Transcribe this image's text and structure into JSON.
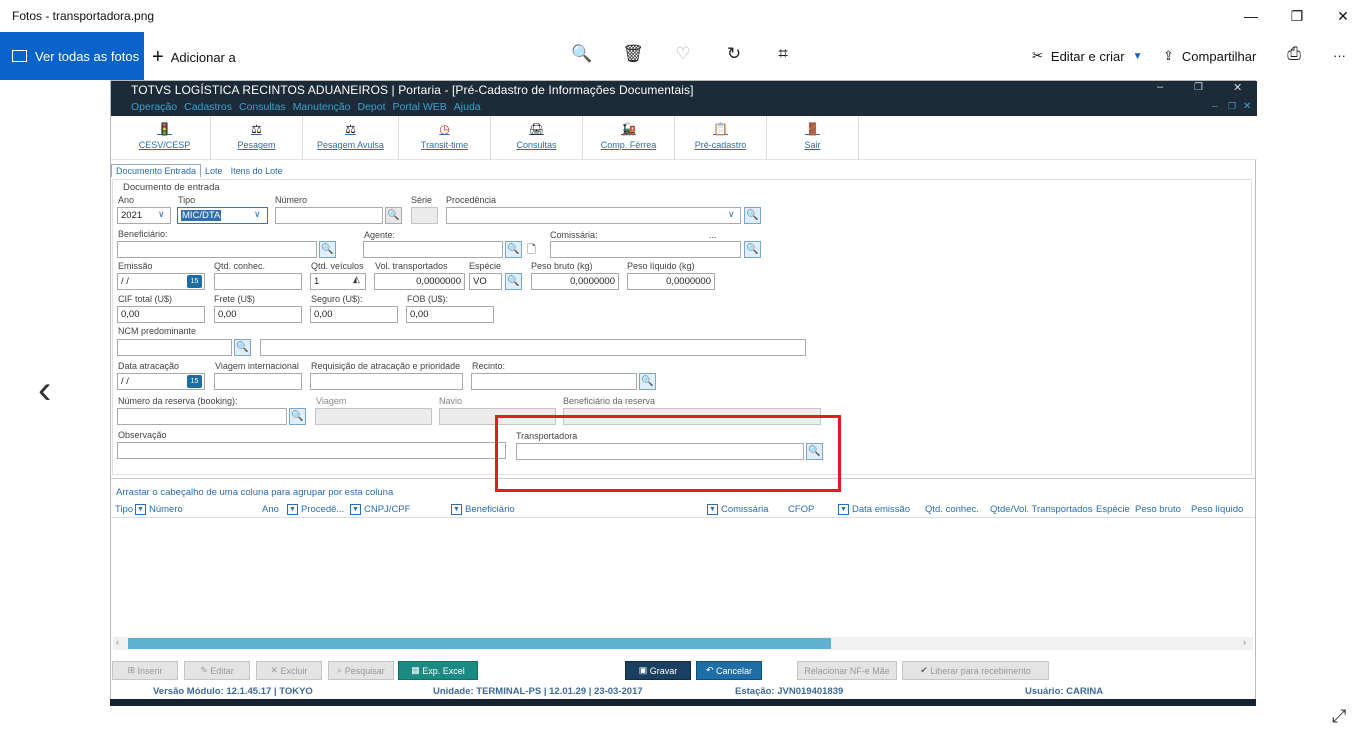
{
  "window": {
    "title": "Fotos - transportadora.png",
    "controls": [
      "—",
      "❐",
      "✕"
    ]
  },
  "photos_toolbar": {
    "view_all": "Ver todas as fotos",
    "add": "Adicionar a",
    "edit_create": "Editar e criar",
    "share": "Compartilhar",
    "more": "···"
  },
  "app": {
    "title": "TOTVS LOGÍSTICA RECINTOS ADUANEIROS | Portaria - [Pré-Cadastro de Informações Documentais]",
    "menu": [
      "Operação",
      "Cadastros",
      "Consultas",
      "Manutenção",
      "Depot",
      "Portal WEB",
      "Ajuda"
    ],
    "window_controls": [
      "–",
      "❐",
      "✕"
    ],
    "sub_controls": [
      "–",
      "❐",
      "✕"
    ],
    "toolbar": [
      "CESV/CESP",
      "Pesagem",
      "Pesagem Avulsa",
      "Transit-time",
      "Consultas",
      "Comp. Férrea",
      "Pré-cadastro",
      "Sair"
    ],
    "tabs": [
      "Documento Entrada",
      "Lote",
      "Itens do Lote"
    ],
    "form": {
      "group_title": "Documento de entrada",
      "ano_label": "Ano",
      "ano_value": "2021",
      "tipo_label": "Tipo",
      "tipo_value": "MIC/DTA",
      "numero_label": "Número",
      "serie_label": "Série",
      "procedencia_label": "Procedência",
      "beneficiario_label": "Beneficiário:",
      "agente_label": "Agente:",
      "comissaria_label": "Comissária:",
      "ellipsis": "...",
      "emissao_label": "Emissão",
      "emissao_value": " / /",
      "qtd_conhec_label": "Qtd. conhec.",
      "qtd_veiculos_label": "Qtd. veículos",
      "qtd_veiculos_value": "1",
      "vol_transportados_label": "Vol. transportados",
      "vol_transportados_value": "0,0000000",
      "especie_label": "Espécie",
      "especie_value": "VO",
      "peso_bruto_label": "Peso bruto (kg)",
      "peso_bruto_value": "0,0000000",
      "peso_liquido_label": "Peso líquido (kg)",
      "peso_liquido_value": "0,0000000",
      "cif_label": "CIF total (U$)",
      "cif_value": "0,00",
      "frete_label": "Frete (U$)",
      "frete_value": "0,00",
      "seguro_label": "Seguro (U$):",
      "seguro_value": "0,00",
      "fob_label": "FOB (U$):",
      "fob_value": "0,00",
      "ncm_label": "NCM predominante",
      "data_atracacao_label": "Data atracação",
      "data_atracacao_value": " / /",
      "viagem_internacional_label": "Viagem internacional",
      "requisicao_label": "Requisição de atracação e prioridade",
      "recinto_label": "Recinto:",
      "reserva_label": "Número da reserva (booking):",
      "viagem_label": "Viagem",
      "navio_label": "Navio",
      "beneficiario_reserva_label": "Beneficiário da reserva",
      "observacao_label": "Observação",
      "transportadora_label": "Transportadora"
    },
    "grid": {
      "hint": "Arrastar o cabeçalho de uma coluna para agrupar por esta coluna",
      "columns": [
        "Tipo",
        "Número",
        "Ano",
        "Procedê...",
        "CNPJ/CPF",
        "Beneficiário",
        "Comissária",
        "CFOP",
        "Data emissão",
        "Qtd. conhec.",
        "Qtde/Vol. Transportados",
        "Espécie",
        "Peso bruto",
        "Peso líquido"
      ]
    },
    "buttons": {
      "inserir": "Inserir",
      "editar": "Editar",
      "excluir": "Excluir",
      "pesquisar": "Pesquisar",
      "exp_excel": "Exp. Excel",
      "gravar": "Gravar",
      "cancelar": "Cancelar",
      "relacionar": "Relacionar NF-e Mãe",
      "liberar": "Liberar para recebimento"
    },
    "status": {
      "versao": "Versão Módulo:  12.1.45.17  |  TOKYO",
      "unidade": "Unidade:  TERMINAL-PS | 12.01.29 | 23-03-2017",
      "estacao": "Estação:  JVN019401839",
      "usuario": "Usuário:  CARINA"
    }
  },
  "colors": {
    "accent": "#0a63c9",
    "app_header": "#1d2b38",
    "highlight": "#e41b23"
  }
}
